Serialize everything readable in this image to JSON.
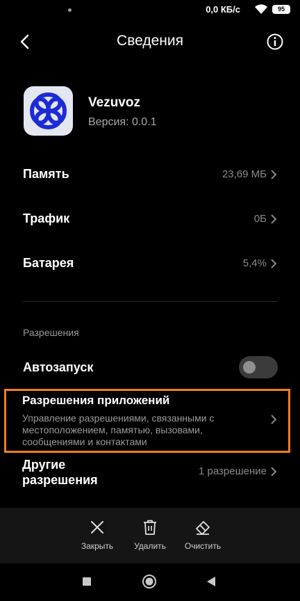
{
  "status_bar": {
    "speed": "0,0 КБ/с",
    "battery": "95"
  },
  "header": {
    "title": "Сведения"
  },
  "app": {
    "name": "Vezuvoz",
    "version": "Версия: 0.0.1",
    "icon_color": "#1b2bd6"
  },
  "rows": [
    {
      "label": "Память",
      "value": "23,69 МБ"
    },
    {
      "label": "Трафик",
      "value": "0Б"
    },
    {
      "label": "Батарея",
      "value": "5,4%"
    }
  ],
  "permissions": {
    "section_title": "Разрешения",
    "autostart": {
      "label": "Автозапуск",
      "enabled": false
    },
    "app_permissions": {
      "title": "Разрешения приложений",
      "description": "Управление разрешениями, связанными с местоположением, памятью, вызовами, сообщениями и контактами"
    },
    "other": {
      "title": "Другие разрешения",
      "value": "1 разрешение"
    }
  },
  "actions": [
    {
      "label": "Закрыть",
      "icon": "close-icon"
    },
    {
      "label": "Удалить",
      "icon": "trash-icon"
    },
    {
      "label": "Очистить",
      "icon": "eraser-icon"
    }
  ],
  "nav": [
    "recents-icon",
    "home-icon",
    "back-icon"
  ],
  "colors": {
    "highlight": "#f57c22",
    "background": "#000000"
  }
}
